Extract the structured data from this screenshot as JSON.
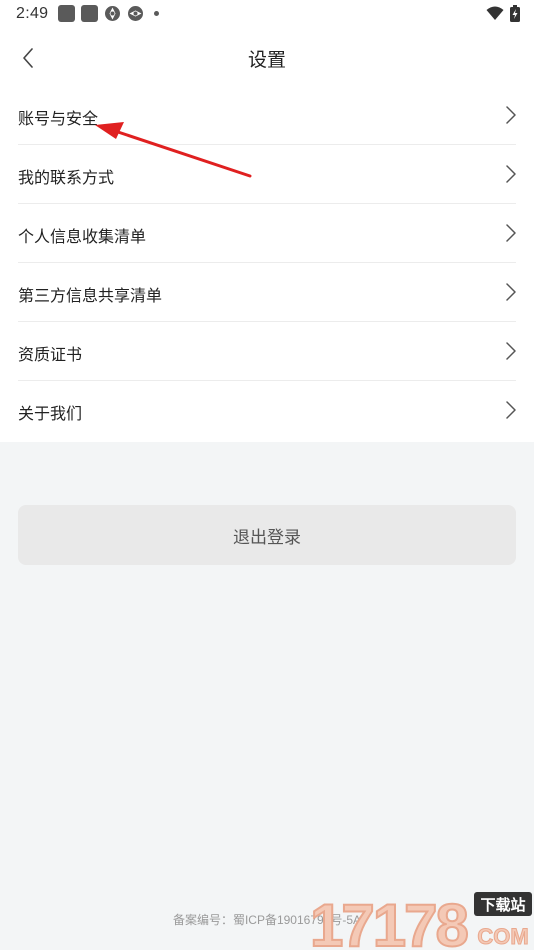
{
  "status_bar": {
    "time": "2:49",
    "left_icons": [
      "notification-square-icon",
      "notification-square-icon",
      "aperture-icon",
      "aperture-icon",
      "more-dot-icon"
    ],
    "right_icons": [
      "wifi-icon",
      "battery-charging-icon"
    ]
  },
  "header": {
    "title": "设置",
    "back_icon": "chevron-left-icon"
  },
  "settings": {
    "items": [
      {
        "label": "账号与安全",
        "icon": "chevron-right-icon"
      },
      {
        "label": "我的联系方式",
        "icon": "chevron-right-icon"
      },
      {
        "label": "个人信息收集清单",
        "icon": "chevron-right-icon"
      },
      {
        "label": "第三方信息共享清单",
        "icon": "chevron-right-icon"
      },
      {
        "label": "资质证书",
        "icon": "chevron-right-icon"
      },
      {
        "label": "关于我们",
        "icon": "chevron-right-icon"
      }
    ]
  },
  "logout": {
    "label": "退出登录"
  },
  "footer": {
    "icp": "备案编号：蜀ICP备19016799号-5A"
  },
  "watermark": {
    "text": "17178",
    "sub": "下载站",
    "domain": "COM"
  },
  "colors": {
    "background": "#f3f5f6",
    "card": "#ffffff",
    "logout_button": "#e9e9e9",
    "annotation_arrow": "#e02020",
    "text_primary": "#222222",
    "text_muted": "#9a9a9a"
  }
}
